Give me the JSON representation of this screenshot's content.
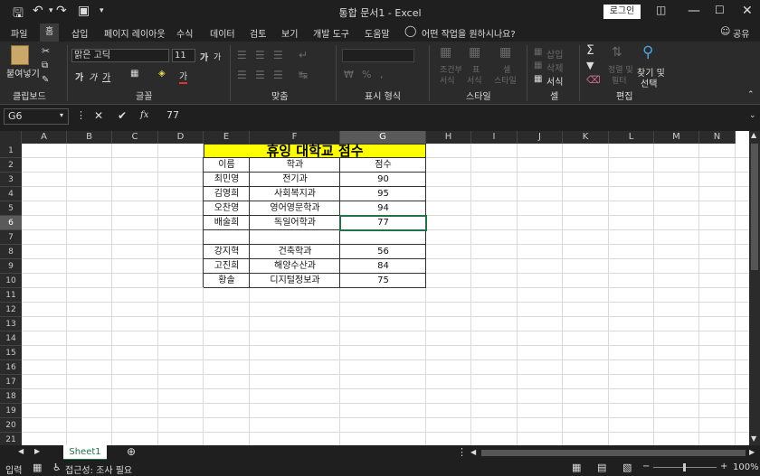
{
  "window": {
    "title": "통합 문서1  -  Excel",
    "login_label": "로그인"
  },
  "menu": {
    "tabs": [
      "파일",
      "홈",
      "삽입",
      "페이지 레이아웃",
      "수식",
      "데이터",
      "검토",
      "보기",
      "개발 도구",
      "도움말"
    ],
    "search_placeholder": "어떤 작업을 원하시나요?",
    "share_label": "공유"
  },
  "ribbon": {
    "groups": [
      "클립보드",
      "글꼴",
      "맞춤",
      "표시 형식",
      "스타일",
      "셀",
      "편집"
    ],
    "paste_label": "붙여넣기",
    "font_name": "맑은 고딕",
    "font_size": "11",
    "find_label": "찾기 및",
    "find_label2": "선택",
    "cells_buttons": [
      "삽입",
      "삭제",
      "서식"
    ],
    "style_buttons": [
      "조건부",
      "서식",
      "표",
      "서식",
      "셀",
      "스타일"
    ],
    "edit_buttons": [
      "정렬 및",
      "필터"
    ],
    "bold": "가",
    "italic": "가",
    "underline": "가",
    "font_color_glyph": "가",
    "grow_font": "가",
    "shrink_font": "가"
  },
  "formula_bar": {
    "name_box": "G6",
    "fx_label": "fx",
    "formula": "77"
  },
  "columns": [
    "A",
    "B",
    "C",
    "D",
    "E",
    "F",
    "G",
    "H",
    "I",
    "J",
    "K",
    "L",
    "M",
    "N"
  ],
  "rows": [
    "1",
    "2",
    "3",
    "4",
    "5",
    "6",
    "7",
    "8",
    "9",
    "10",
    "11",
    "12",
    "13",
    "14",
    "15",
    "16",
    "17",
    "18",
    "19",
    "20",
    "21"
  ],
  "sheet": {
    "title": "휴잉 대학교 점수",
    "headers": [
      "이름",
      "학과",
      "점수"
    ],
    "data": [
      [
        "최민영",
        "전기과",
        "90"
      ],
      [
        "김영희",
        "사회복지과",
        "95"
      ],
      [
        "오찬영",
        "영어영문학과",
        "94"
      ],
      [
        "배술희",
        "독일어학과",
        "77"
      ],
      [
        "",
        "",
        ""
      ],
      [
        "강지혁",
        "건축학과",
        "56"
      ],
      [
        "고진희",
        "해양수산과",
        "84"
      ],
      [
        "황솔",
        "디지털정보과",
        "75"
      ]
    ]
  },
  "sheet_tabs": [
    "Sheet1"
  ],
  "status": {
    "mode": "입력",
    "accessibility": "접근성: 조사 필요",
    "zoom": "100%"
  },
  "colors": {
    "accent": "#217346",
    "title_fill": "#ffff00"
  }
}
